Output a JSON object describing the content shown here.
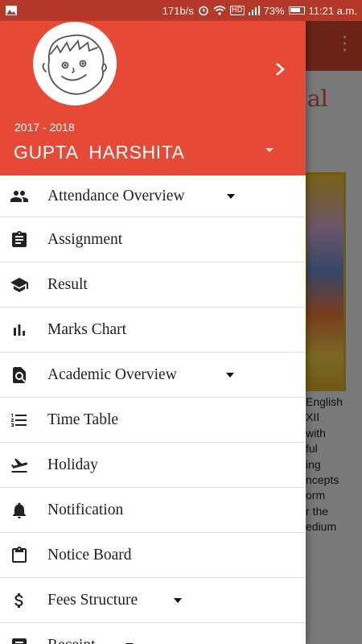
{
  "status_bar": {
    "left_icon": "image-notification-icon",
    "speed": "171b/s",
    "alarm_icon": "alarm-icon",
    "wifi_icon": "wifi-icon",
    "hd_badge": "HD",
    "signal_icon": "signal-icon",
    "battery_percent": "73%",
    "battery_icon": "battery-icon",
    "time": "11:21 a.m."
  },
  "background": {
    "brand_fragment": "al",
    "overflow_icon": "more-vert-icon",
    "text_fragment": "English\nXII\nwith\nful\ning\nncepts\norm\nr the\nedium"
  },
  "drawer": {
    "avatar_icon": "cartoon-child-avatar",
    "next_icon": "chevron-right-icon",
    "session_year": "2017 - 2018",
    "student_name": "GUPTA  HARSHITA",
    "account_dropdown_icon": "arrow-drop-down-icon",
    "items": [
      {
        "label": "Attendance Overview",
        "icon": "people-icon",
        "has_caret": true
      },
      {
        "label": "Assignment",
        "icon": "clipboard-icon",
        "has_caret": false
      },
      {
        "label": "Result",
        "icon": "graduation-cap-icon",
        "has_caret": false
      },
      {
        "label": "Marks Chart",
        "icon": "bar-chart-icon",
        "has_caret": false
      },
      {
        "label": "Academic Overview",
        "icon": "find-in-page-icon",
        "has_caret": true
      },
      {
        "label": "Time Table",
        "icon": "numbered-list-icon",
        "has_caret": false
      },
      {
        "label": "Holiday",
        "icon": "flight-takeoff-icon",
        "has_caret": false
      },
      {
        "label": "Notification",
        "icon": "bell-icon",
        "has_caret": false
      },
      {
        "label": "Notice Board",
        "icon": "notice-clipboard-icon",
        "has_caret": false
      },
      {
        "label": "Fees Structure",
        "icon": "dollar-icon",
        "has_caret": true
      },
      {
        "label": "Receipt",
        "icon": "receipt-icon",
        "has_caret": true
      }
    ]
  },
  "colors": {
    "header_red": "#e64935",
    "status_bar_red": "#b5392a",
    "text_dark": "#1f1f1f",
    "divider": "#e3e3e3"
  }
}
